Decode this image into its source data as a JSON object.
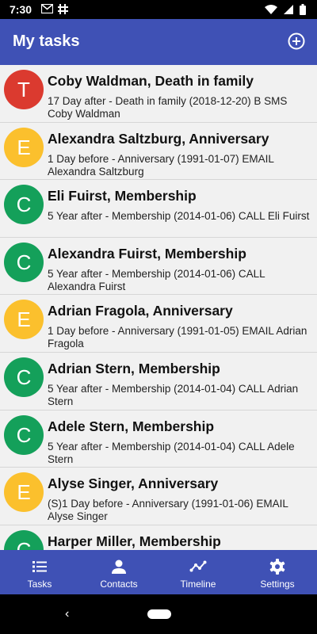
{
  "status": {
    "time": "7:30"
  },
  "colors": {
    "primary": "#3f51b5",
    "T": "#db3a2f",
    "E": "#fbc02d",
    "C": "#14a05a"
  },
  "appbar": {
    "title": "My tasks",
    "add_icon": "add-circle-icon"
  },
  "tasks": [
    {
      "letter": "T",
      "type": "T",
      "title": "Coby Waldman, Death in family",
      "detail": "17 Day after  - Death in family (2018-12-20) B SMS Coby Waldman"
    },
    {
      "letter": "E",
      "type": "E",
      "title": "Alexandra Saltzburg, Anniversary",
      "detail": "1 Day before  - Anniversary (1991-01-07)  EMAIL Alexandra Saltzburg"
    },
    {
      "letter": "C",
      "type": "C",
      "title": "Eli Fuirst, Membership",
      "detail": "5 Year after  - Membership (2014-01-06)  CALL Eli Fuirst"
    },
    {
      "letter": "C",
      "type": "C",
      "title": "Alexandra Fuirst, Membership",
      "detail": "5 Year after  - Membership (2014-01-06)  CALL Alexandra Fuirst"
    },
    {
      "letter": "E",
      "type": "E",
      "title": "Adrian Fragola, Anniversary",
      "detail": "1 Day before  - Anniversary (1991-01-05)  EMAIL Adrian Fragola"
    },
    {
      "letter": "C",
      "type": "C",
      "title": "Adrian Stern, Membership",
      "detail": "5 Year after  - Membership (2014-01-04)  CALL Adrian Stern"
    },
    {
      "letter": "C",
      "type": "C",
      "title": "Adele Stern, Membership",
      "detail": "5 Year after  - Membership (2014-01-04)  CALL Adele Stern"
    },
    {
      "letter": "E",
      "type": "E",
      "title": "Alyse Singer, Anniversary",
      "detail": "(S)1 Day before  - Anniversary (1991-01-06)  EMAIL Alyse Singer"
    },
    {
      "letter": "C",
      "type": "C",
      "title": "Harper Miller, Membership",
      "detail": ""
    }
  ],
  "nav": [
    {
      "label": "Tasks",
      "icon": "list-icon"
    },
    {
      "label": "Contacts",
      "icon": "person-icon"
    },
    {
      "label": "Timeline",
      "icon": "timeline-icon"
    },
    {
      "label": "Settings",
      "icon": "gear-icon"
    }
  ]
}
